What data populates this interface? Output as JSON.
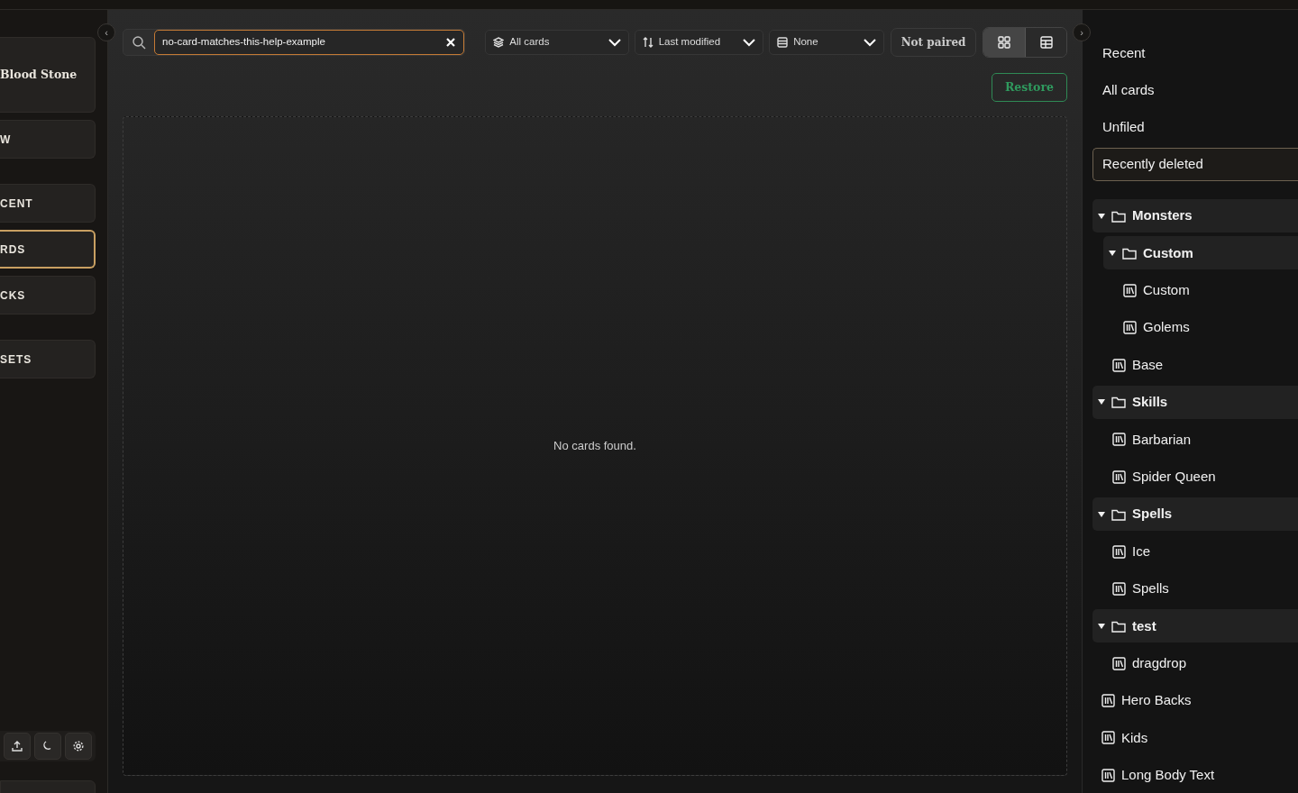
{
  "sidebar": {
    "items": [
      {
        "label": "Blood Stone",
        "kind": "title",
        "selected": false
      },
      {
        "label": "W",
        "kind": "nav",
        "selected": false
      },
      {
        "label": "CENT",
        "kind": "nav",
        "selected": false
      },
      {
        "label": "RDS",
        "kind": "nav",
        "selected": true
      },
      {
        "label": "CKS",
        "kind": "nav",
        "selected": false
      },
      {
        "label": "SETS",
        "kind": "nav",
        "selected": false
      }
    ]
  },
  "collapse_left": "‹",
  "collapse_right": "›",
  "toolbar": {
    "search": {
      "value": "no-card-matches-this-help-example"
    },
    "filter": "All cards",
    "sort": "Last modified",
    "group": "None",
    "pair_button": "Not paired",
    "views": [
      {
        "kind": "grid",
        "selected": true
      },
      {
        "kind": "table",
        "selected": false
      }
    ]
  },
  "restore_button": "Restore",
  "empty_message": "No cards found.",
  "collections": [
    {
      "label": "Recent",
      "selected": false
    },
    {
      "label": "All cards",
      "selected": false
    },
    {
      "label": "Unfiled",
      "selected": false
    },
    {
      "label": "Recently deleted",
      "selected": true
    }
  ],
  "tree": [
    {
      "kind": "folder",
      "label": "Monsters",
      "expanded": true,
      "children": [
        {
          "kind": "folder",
          "label": "Custom",
          "expanded": true,
          "children": [
            {
              "kind": "deck",
              "label": "Custom"
            },
            {
              "kind": "deck",
              "label": "Golems"
            }
          ]
        },
        {
          "kind": "deck",
          "label": "Base"
        }
      ]
    },
    {
      "kind": "folder",
      "label": "Skills",
      "expanded": true,
      "children": [
        {
          "kind": "deck",
          "label": "Barbarian"
        },
        {
          "kind": "deck",
          "label": "Spider Queen"
        }
      ]
    },
    {
      "kind": "folder",
      "label": "Spells",
      "expanded": true,
      "children": [
        {
          "kind": "deck",
          "label": "Ice"
        },
        {
          "kind": "deck",
          "label": "Spells"
        }
      ]
    },
    {
      "kind": "folder",
      "label": "test",
      "expanded": true,
      "children": [
        {
          "kind": "deck",
          "label": "dragdrop"
        }
      ]
    },
    {
      "kind": "deck",
      "label": "Hero Backs"
    },
    {
      "kind": "deck",
      "label": "Kids"
    },
    {
      "kind": "deck",
      "label": "Long Body Text"
    }
  ]
}
